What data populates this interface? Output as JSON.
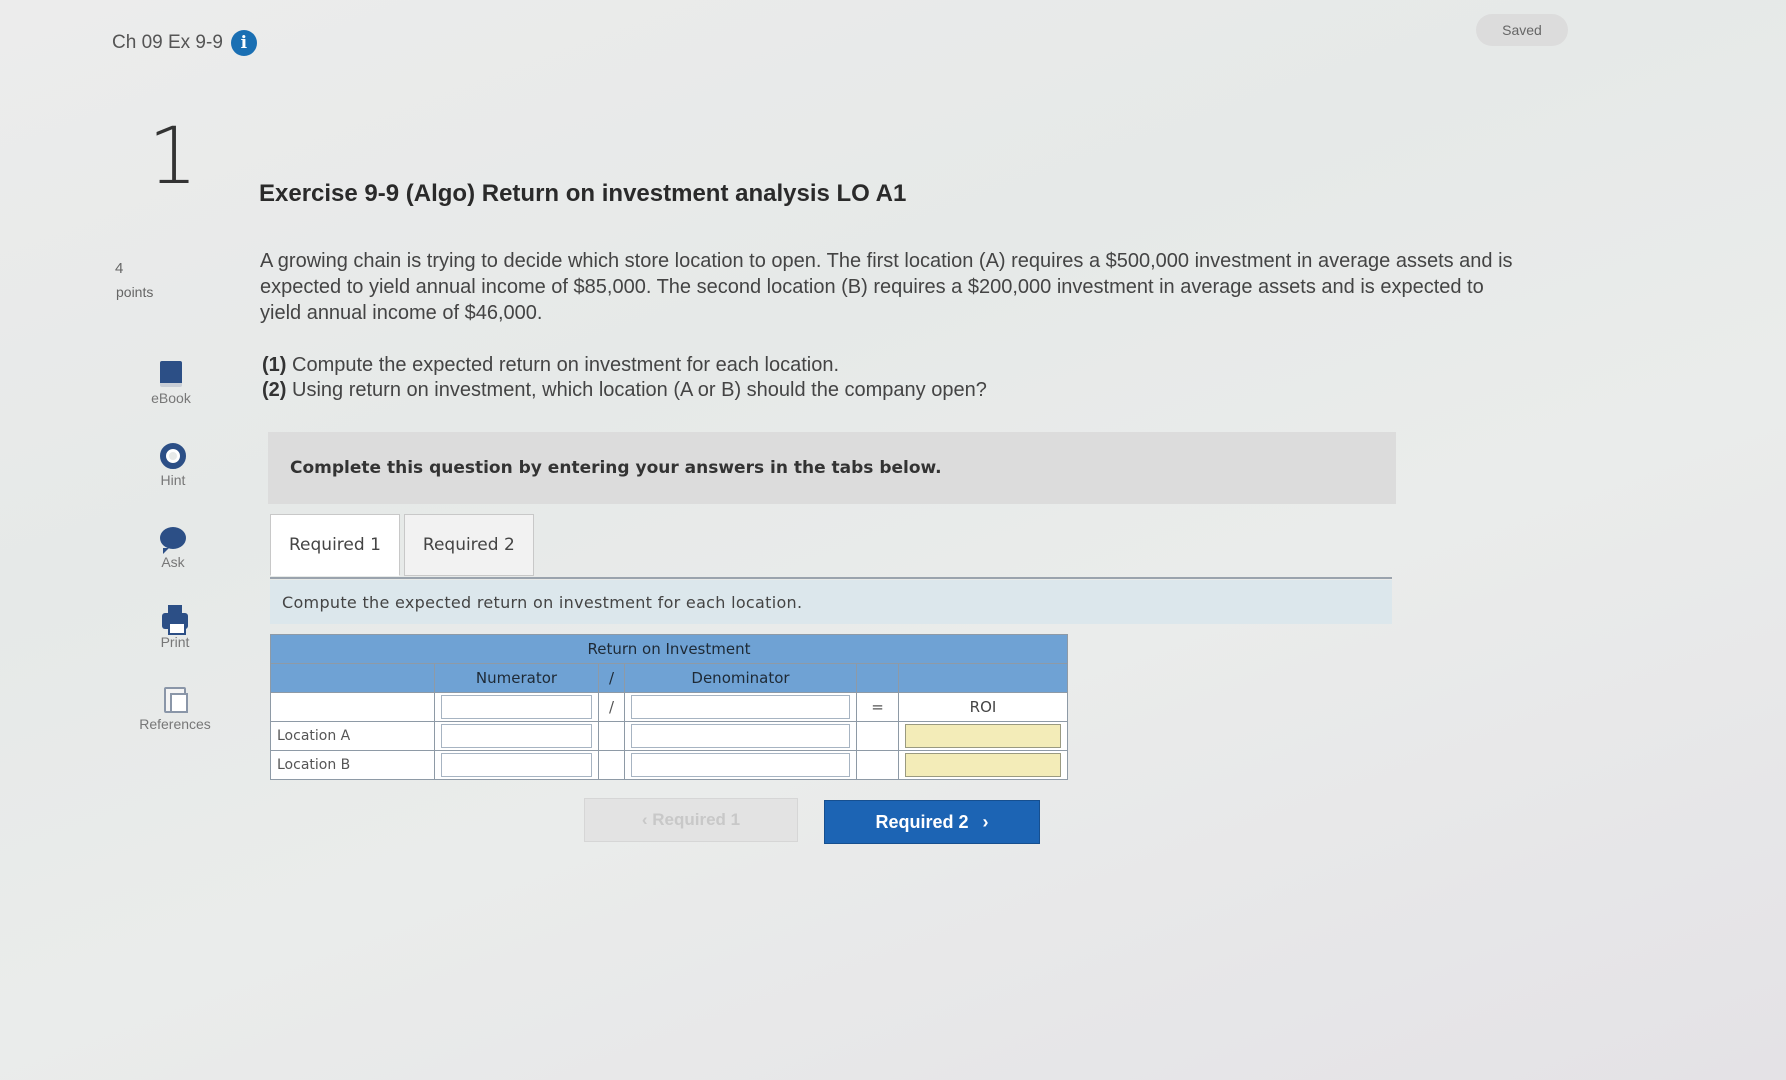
{
  "header": {
    "breadcrumb": "Ch 09 Ex 9-9",
    "saved": "Saved"
  },
  "rail": {
    "question_number": "1",
    "points_value": "4",
    "points_label": "points",
    "tools": [
      {
        "label": "eBook",
        "icon": "book-icon"
      },
      {
        "label": "Hint",
        "icon": "lifebuoy-icon"
      },
      {
        "label": "Ask",
        "icon": "chat-bubble-icon"
      },
      {
        "label": "Print",
        "icon": "printer-icon"
      },
      {
        "label": "References",
        "icon": "documents-icon"
      }
    ]
  },
  "question": {
    "title": "Exercise 9-9 (Algo) Return on investment analysis LO A1",
    "body": "A growing chain is trying to decide which store location to open. The first location (A) requires a $500,000 investment in average assets and is expected to yield annual income of $85,000. The second location (B) requires a $200,000 investment in average assets and is expected to yield annual income of $46,000.",
    "req1_num": "(1)",
    "req1_text": "Compute the expected return on investment for each location.",
    "req2_num": "(2)",
    "req2_text": "Using return on investment, which location (A or B) should the company open?"
  },
  "banner": "Complete this question by entering your answers in the tabs below.",
  "tabs": [
    "Required 1",
    "Required 2"
  ],
  "tab_description": "Compute the expected return on investment for each location.",
  "table": {
    "title": "Return on Investment",
    "numerator": "Numerator",
    "divide": "/",
    "denominator": "Denominator",
    "equals": "=",
    "result": "ROI",
    "rows": [
      "Location A",
      "Location B"
    ]
  },
  "nav": {
    "prev": "Required 1",
    "next": "Required 2"
  }
}
